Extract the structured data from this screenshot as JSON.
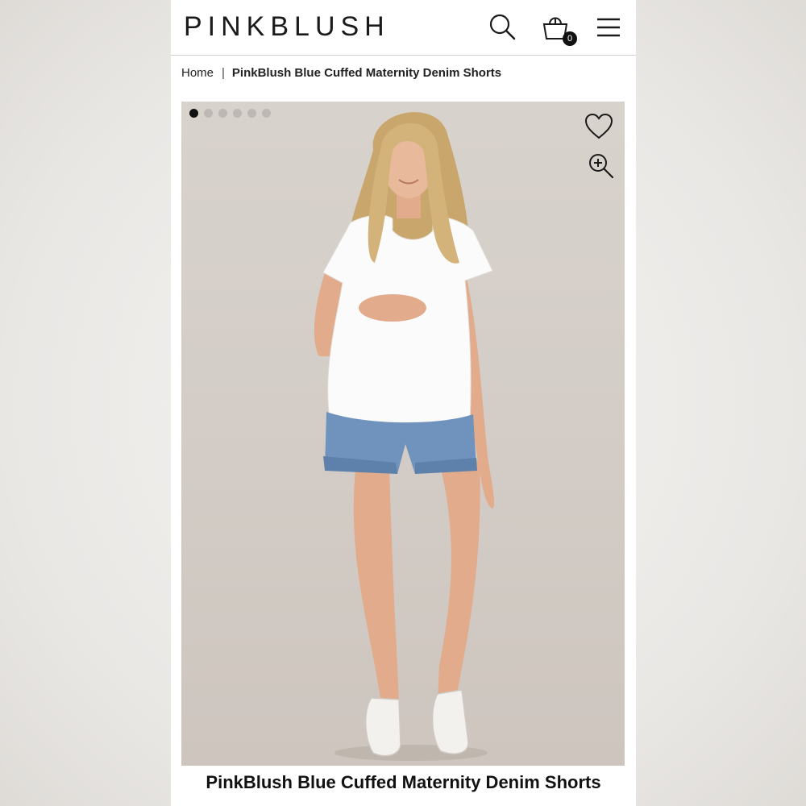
{
  "header": {
    "logo": "PINKBLUSH",
    "bag_count": "0"
  },
  "breadcrumb": {
    "home": "Home",
    "separator": "|",
    "current": "PinkBlush Blue Cuffed Maternity Denim Shorts"
  },
  "gallery": {
    "dot_count": 6,
    "active_index": 0
  },
  "product": {
    "title": "PinkBlush Blue Cuffed Maternity Denim Shorts"
  },
  "icons": [
    "search-icon",
    "shopping-bag-icon",
    "hamburger-menu-icon",
    "heart-icon",
    "zoom-in-icon"
  ],
  "colors": {
    "photo_bg": "#d6cfc9",
    "dot_active": "#111111",
    "dot_inactive": "#bdb8b4"
  }
}
